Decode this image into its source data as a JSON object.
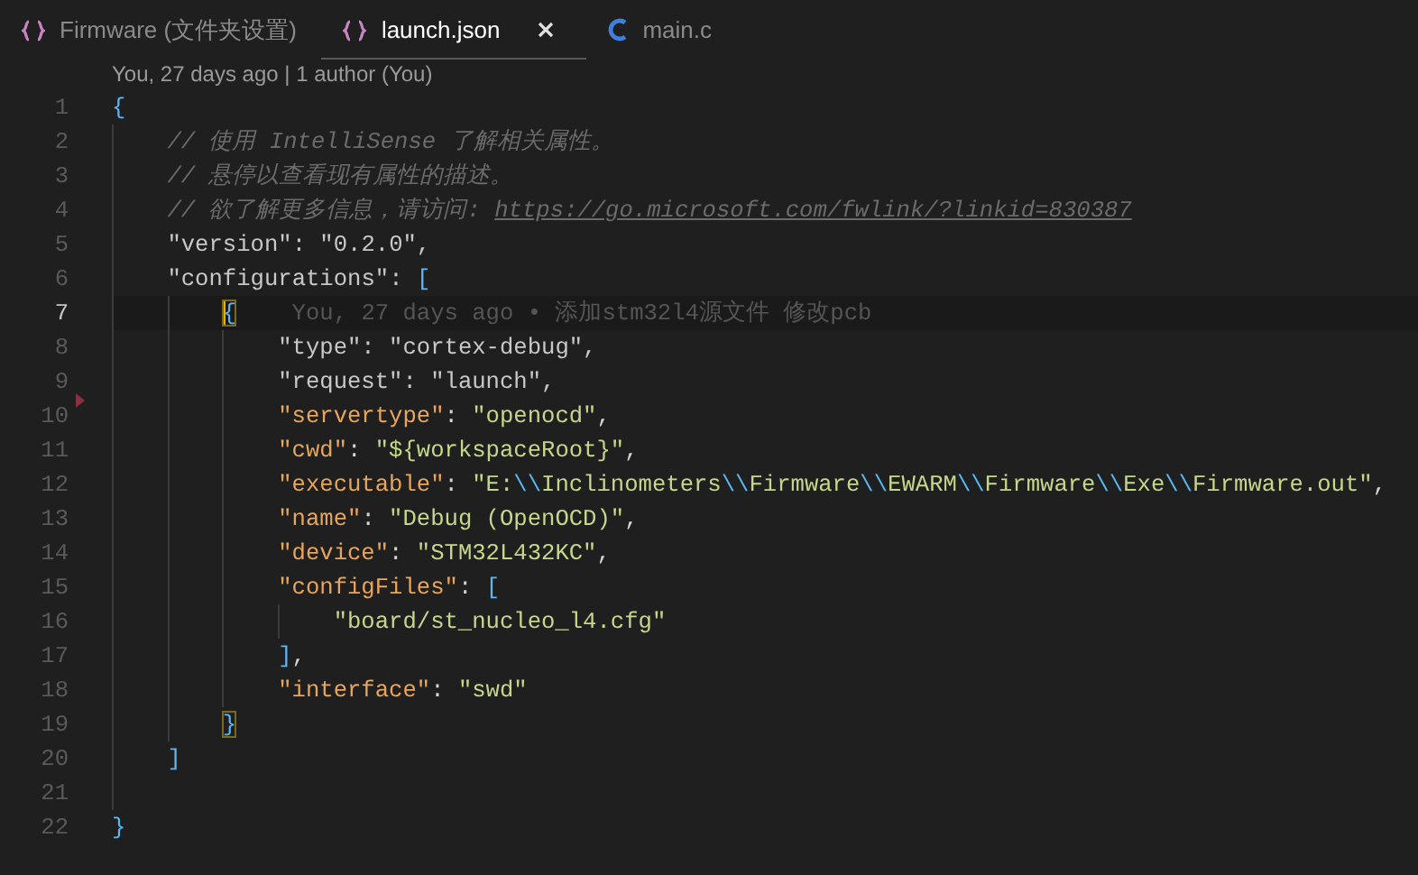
{
  "tabs": [
    {
      "label": "Firmware (文件夹设置)",
      "kind": "braces",
      "selected": false
    },
    {
      "label": "launch.json",
      "kind": "braces",
      "selected": true,
      "closable": true
    },
    {
      "label": "main.c",
      "kind": "c",
      "selected": false
    }
  ],
  "codelens": "You, 27 days ago | 1 author (You)",
  "lines": [
    {
      "number": "1",
      "tokens": [
        {
          "kind": "bracket",
          "text": "{"
        }
      ]
    },
    {
      "number": "2",
      "tokens": [
        {
          "kind": "comment",
          "text": "// 使用 IntelliSense 了解相关属性。"
        }
      ]
    },
    {
      "number": "3",
      "tokens": [
        {
          "kind": "comment",
          "text": "// 悬停以查看现有属性的描述。"
        }
      ]
    },
    {
      "number": "4",
      "tokens": [
        {
          "kind": "comment",
          "text": "// 欲了解更多信息，请访问: "
        },
        {
          "kind": "link",
          "text": "https://go.microsoft.com/fwlink/?linkid=830387"
        }
      ]
    },
    {
      "number": "5",
      "tokens": [
        {
          "kind": "plain",
          "text": "\"version\": \"0.2.0\","
        }
      ]
    },
    {
      "number": "6",
      "tokens": [
        {
          "kind": "plain",
          "text": "\"configurations\": "
        },
        {
          "kind": "bracket",
          "text": "["
        }
      ]
    },
    {
      "number": "7",
      "current": true,
      "blame": "You, 27 days ago • 添加stm32l4源文件 修改pcb",
      "tokens": [
        {
          "kind": "bracket",
          "text": "{",
          "matched": true
        }
      ]
    },
    {
      "number": "8",
      "tokens": [
        {
          "kind": "plain",
          "text": "\"type\": \"cortex-debug\","
        }
      ]
    },
    {
      "number": "9",
      "tokens": [
        {
          "kind": "plain",
          "text": "\"request\": \"launch\","
        }
      ]
    },
    {
      "number": "10",
      "deleted_marker": true,
      "tokens": [
        {
          "kind": "key",
          "text": "\"servertype\""
        },
        {
          "kind": "punct",
          "text": ": "
        },
        {
          "kind": "string",
          "text": "\"openocd\""
        },
        {
          "kind": "punct",
          "text": ","
        }
      ]
    },
    {
      "number": "11",
      "tokens": [
        {
          "kind": "key",
          "text": "\"cwd\""
        },
        {
          "kind": "punct",
          "text": ": "
        },
        {
          "kind": "string",
          "text": "\"${workspaceRoot}\""
        },
        {
          "kind": "punct",
          "text": ","
        }
      ]
    },
    {
      "number": "12",
      "tokens": [
        {
          "kind": "key",
          "text": "\"executable\""
        },
        {
          "kind": "punct",
          "text": ": "
        },
        {
          "kind": "string",
          "text": "\"E:"
        },
        {
          "kind": "escape",
          "text": "\\\\"
        },
        {
          "kind": "string",
          "text": "Inclinometers"
        },
        {
          "kind": "escape",
          "text": "\\\\"
        },
        {
          "kind": "string",
          "text": "Firmware"
        },
        {
          "kind": "escape",
          "text": "\\\\"
        },
        {
          "kind": "string",
          "text": "EWARM"
        },
        {
          "kind": "escape",
          "text": "\\\\"
        },
        {
          "kind": "string",
          "text": "Firmware"
        },
        {
          "kind": "escape",
          "text": "\\\\"
        },
        {
          "kind": "string",
          "text": "Exe"
        },
        {
          "kind": "escape",
          "text": "\\\\"
        },
        {
          "kind": "string",
          "text": "Firmware.out\""
        },
        {
          "kind": "punct",
          "text": ","
        }
      ]
    },
    {
      "number": "13",
      "tokens": [
        {
          "kind": "key",
          "text": "\"name\""
        },
        {
          "kind": "punct",
          "text": ": "
        },
        {
          "kind": "string",
          "text": "\"Debug (OpenOCD)\""
        },
        {
          "kind": "punct",
          "text": ","
        }
      ]
    },
    {
      "number": "14",
      "tokens": [
        {
          "kind": "key",
          "text": "\"device\""
        },
        {
          "kind": "punct",
          "text": ": "
        },
        {
          "kind": "string",
          "text": "\"STM32L432KC\""
        },
        {
          "kind": "punct",
          "text": ","
        }
      ]
    },
    {
      "number": "15",
      "tokens": [
        {
          "kind": "key",
          "text": "\"configFiles\""
        },
        {
          "kind": "punct",
          "text": ": "
        },
        {
          "kind": "bracket",
          "text": "["
        }
      ]
    },
    {
      "number": "16",
      "tokens": [
        {
          "kind": "string",
          "text": "\"board/st_nucleo_l4.cfg\""
        }
      ]
    },
    {
      "number": "17",
      "tokens": [
        {
          "kind": "bracket",
          "text": "]"
        },
        {
          "kind": "punct",
          "text": ","
        }
      ]
    },
    {
      "number": "18",
      "tokens": [
        {
          "kind": "key",
          "text": "\"interface\""
        },
        {
          "kind": "punct",
          "text": ": "
        },
        {
          "kind": "string",
          "text": "\"swd\""
        }
      ]
    },
    {
      "number": "19",
      "tokens": [
        {
          "kind": "bracket",
          "text": "}",
          "matched": true
        }
      ]
    },
    {
      "number": "20",
      "tokens": [
        {
          "kind": "bracket",
          "text": "]"
        }
      ]
    },
    {
      "number": "21"
    },
    {
      "number": "22",
      "tokens": [
        {
          "kind": "bracket",
          "text": "}"
        }
      ]
    }
  ]
}
